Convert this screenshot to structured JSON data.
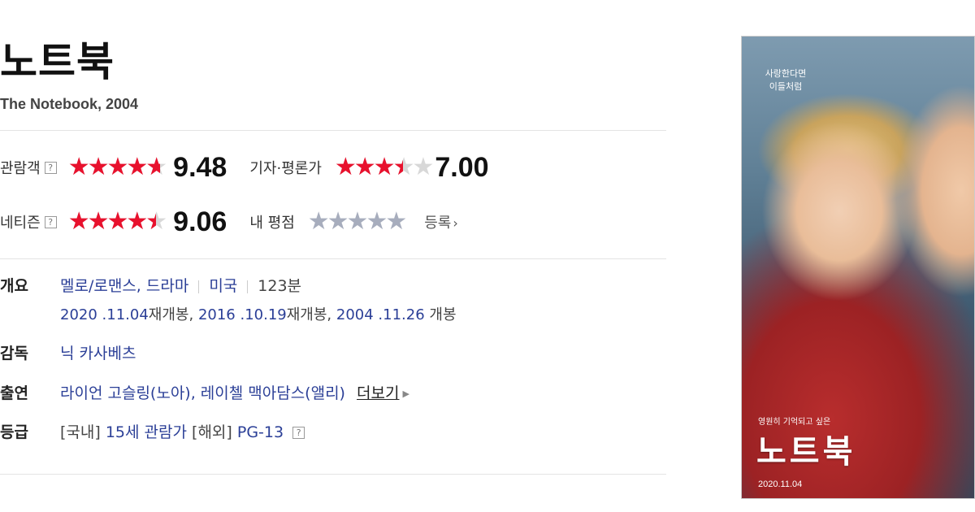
{
  "movie": {
    "title": "노트북",
    "original_title_year": "The Notebook, 2004"
  },
  "ratings": {
    "audience": {
      "label": "관람객",
      "help": "?",
      "score": "9.48",
      "fraction": 0.948
    },
    "critics": {
      "label": "기자·평론가",
      "score": "7.00",
      "fraction": 0.7
    },
    "netizen": {
      "label": "네티즌",
      "help": "?",
      "score": "9.06",
      "fraction": 0.906
    },
    "mine": {
      "label": "내 평점",
      "register_label": "등록"
    }
  },
  "stars_glyphs": "★★★★★",
  "info": {
    "overview": {
      "label": "개요",
      "genre": "멜로/로맨스, 드라마",
      "country": "미국",
      "runtime": "123분",
      "release_dates": [
        {
          "date": "2020 .11.04",
          "kind": "재개봉"
        },
        {
          "date": "2016 .10.19",
          "kind": "재개봉"
        },
        {
          "date": "2004 .11.26",
          "kind": "개봉"
        }
      ]
    },
    "director": {
      "label": "감독",
      "name": "닉 카사베츠"
    },
    "cast": {
      "label": "출연",
      "names": "라이언 고슬링(노아), 레이첼 맥아담스(앨리)",
      "more_label": "더보기"
    },
    "rating": {
      "label": "등급",
      "domestic_prefix": "[국내]",
      "domestic": "15세 관람가",
      "overseas_prefix": "[해외]",
      "overseas": "PG-13",
      "help": "?"
    }
  },
  "poster": {
    "tagline": "사랑한다면 이들처럼",
    "small_caption": "영원히 기억되고 싶은",
    "big_title": "노트북",
    "date": "2020.11.04"
  },
  "colors": {
    "star_red": "#e8112d",
    "star_grey": "#a7adbd",
    "link_blue": "#2b3f97"
  }
}
